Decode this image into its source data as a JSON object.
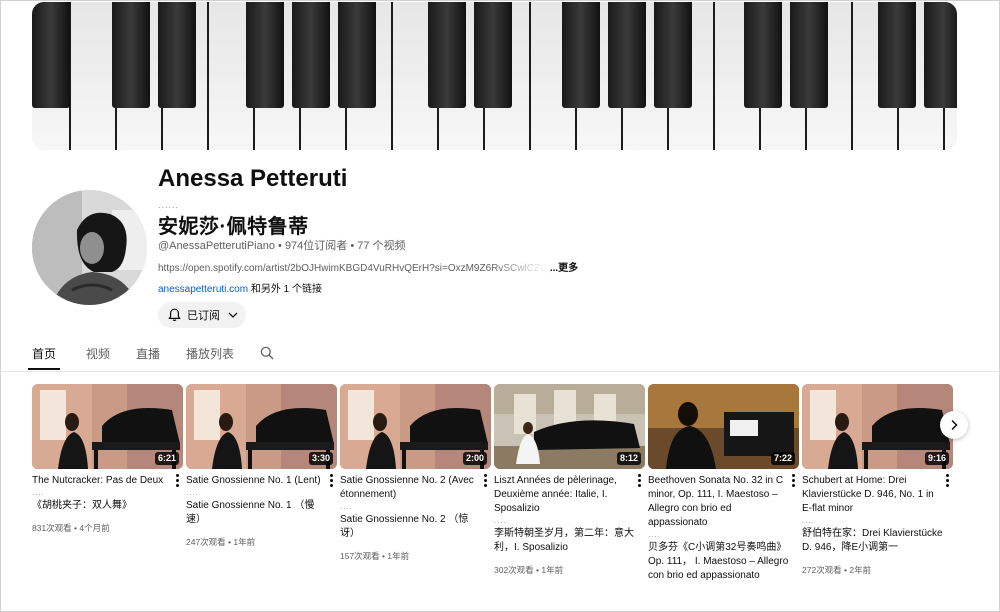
{
  "channel": {
    "name": "Anessa Petteruti",
    "name_dots": "......",
    "name_cn": "安妮莎·佩特鲁蒂",
    "handle": "@AnessaPetterutiPiano",
    "subscribers": "974位订阅者",
    "video_count": "77 个视频",
    "separator": " • ",
    "description": "https://open.spotify.com/artist/2bOJHwimKBGD4VuRHvQErH?si=OxzM9Z6RvSCwlCZQ",
    "more_label": "...更多",
    "website": "anessapetteruti.com",
    "more_links": " 和另外 1 个链接",
    "subscribe_label": "已订阅"
  },
  "tabs": [
    "首页",
    "视频",
    "直播",
    "播放列表"
  ],
  "videos": [
    {
      "title": "The Nutcracker: Pas de Deux",
      "dots": "....",
      "translation": "《胡桃夹子：双人舞》",
      "views": "831次观看",
      "age": "4个月前",
      "duration": "6:21"
    },
    {
      "title": "Satie Gnossienne No. 1 (Lent)",
      "dots": "....",
      "translation": "Satie Gnossienne No. 1 （慢速）",
      "views": "247次观看",
      "age": "1年前",
      "duration": "3:30"
    },
    {
      "title": "Satie Gnossienne No. 2 (Avec étonnement)",
      "dots": "....",
      "translation": "Satie Gnossienne No. 2 （惊讶）",
      "views": "157次观看",
      "age": "1年前",
      "duration": "2:00"
    },
    {
      "title": "Liszt Années de pèlerinage, Deuxième année: Italie, I. Sposalizio",
      "dots": "....",
      "translation": "李斯特朝圣岁月，第二年：意大利，I. Sposalizio",
      "views": "302次观看",
      "age": "1年前",
      "duration": "8:12"
    },
    {
      "title": "Beethoven Sonata No. 32 in C minor, Op. 111, I. Maestoso – Allegro con brio ed appassionato",
      "dots": "....",
      "translation": "贝多芬《C小调第32号奏鸣曲》Op. 111， I. Maestoso – Allegro con brio ed appassionato",
      "views": "",
      "age": "",
      "duration": "7:22"
    },
    {
      "title": "Schubert at Home: Drei Klavierstücke D. 946, No. 1 in E-flat minor",
      "dots": "....",
      "translation": "舒伯特在家：Drei Klavierstücke D. 946，降E小调第一",
      "views": "272次观看",
      "age": "2年前",
      "duration": "9:16"
    }
  ],
  "meta_separator": " • ",
  "colors": {
    "link": "#065fd4",
    "text_primary": "#0f0f0f",
    "text_secondary": "#606060",
    "chip_bg": "#f2f2f2"
  }
}
